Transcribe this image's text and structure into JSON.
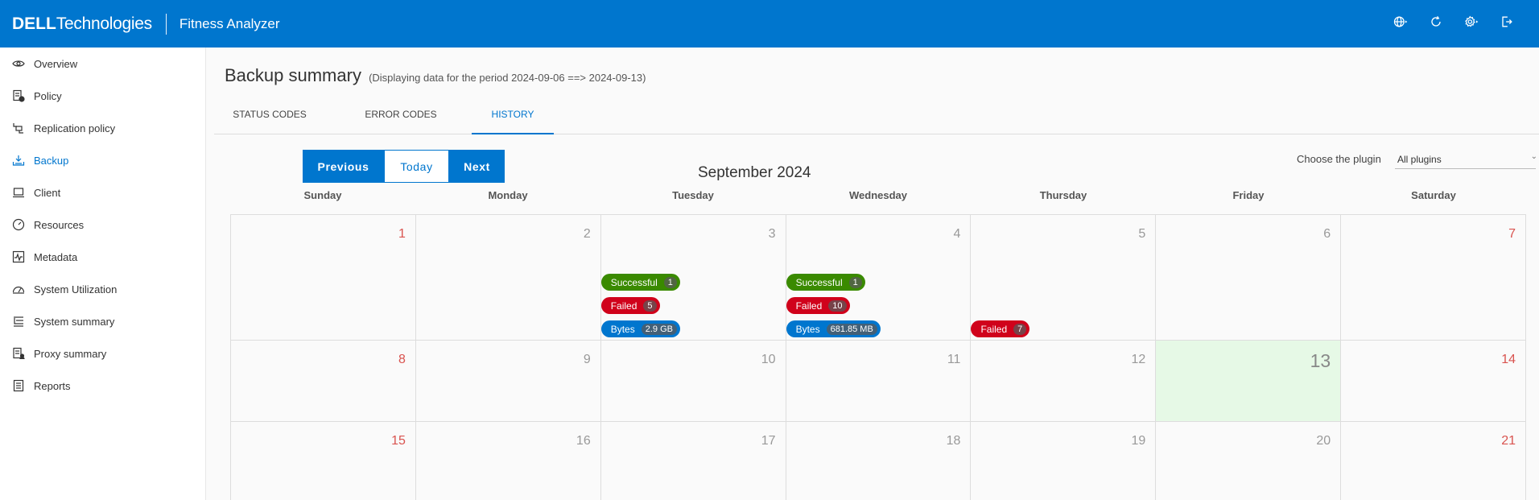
{
  "header": {
    "brand": "DELL",
    "brand_suffix": "Technologies",
    "app_title": "Fitness Analyzer",
    "icons": [
      "globe-icon",
      "refresh-icon",
      "gear-icon",
      "logout-icon"
    ]
  },
  "sidebar": {
    "items": [
      {
        "label": "Overview",
        "icon": "eye-icon",
        "active": false
      },
      {
        "label": "Policy",
        "icon": "policy-icon",
        "active": false
      },
      {
        "label": "Replication policy",
        "icon": "replication-icon",
        "active": false
      },
      {
        "label": "Backup",
        "icon": "backup-icon",
        "active": true
      },
      {
        "label": "Client",
        "icon": "laptop-icon",
        "active": false
      },
      {
        "label": "Resources",
        "icon": "gauge-icon",
        "active": false
      },
      {
        "label": "Metadata",
        "icon": "pulse-icon",
        "active": false
      },
      {
        "label": "System Utilization",
        "icon": "speedometer-icon",
        "active": false
      },
      {
        "label": "System summary",
        "icon": "list-tree-icon",
        "active": false
      },
      {
        "label": "Proxy summary",
        "icon": "proxy-icon",
        "active": false
      },
      {
        "label": "Reports",
        "icon": "report-icon",
        "active": false
      }
    ]
  },
  "main": {
    "title": "Backup summary",
    "subtitle": "(Displaying data for the period 2024-09-06 ==> 2024-09-13)",
    "tabs": [
      {
        "label": "STATUS CODES",
        "active": false
      },
      {
        "label": "ERROR CODES",
        "active": false
      },
      {
        "label": "HISTORY",
        "active": true
      }
    ]
  },
  "calendar": {
    "previous_label": "Previous",
    "today_label": "Today",
    "next_label": "Next",
    "month_title": "September 2024",
    "plugin_label": "Choose the plugin",
    "plugin_value": "All plugins",
    "weekdays": [
      "Sunday",
      "Monday",
      "Tuesday",
      "Wednesday",
      "Thursday",
      "Friday",
      "Saturday"
    ],
    "weeks": [
      [
        {
          "day": "1",
          "weekend": true
        },
        {
          "day": "2"
        },
        {
          "day": "3",
          "events": [
            {
              "type": "success",
              "label": "Successful",
              "count": "1"
            },
            {
              "type": "failed",
              "label": "Failed",
              "count": "5"
            },
            {
              "type": "bytes",
              "label": "Bytes",
              "count": "2.9 GB"
            }
          ]
        },
        {
          "day": "4",
          "events": [
            {
              "type": "success",
              "label": "Successful",
              "count": "1"
            },
            {
              "type": "failed",
              "label": "Failed",
              "count": "10"
            },
            {
              "type": "bytes",
              "label": "Bytes",
              "count": "681.85 MB"
            }
          ]
        },
        {
          "day": "5",
          "events": [
            {
              "type": "failed",
              "label": "Failed",
              "count": "7"
            }
          ]
        },
        {
          "day": "6"
        },
        {
          "day": "7",
          "weekend": true
        }
      ],
      [
        {
          "day": "8",
          "weekend": true
        },
        {
          "day": "9"
        },
        {
          "day": "10"
        },
        {
          "day": "11"
        },
        {
          "day": "12"
        },
        {
          "day": "13",
          "today": true
        },
        {
          "day": "14",
          "weekend": true
        }
      ],
      [
        {
          "day": "15",
          "weekend": true
        },
        {
          "day": "16"
        },
        {
          "day": "17"
        },
        {
          "day": "18"
        },
        {
          "day": "19"
        },
        {
          "day": "20"
        },
        {
          "day": "21",
          "weekend": true
        }
      ]
    ]
  },
  "colors": {
    "header_bg": "#0076ce",
    "accent": "#0076ce",
    "success": "#3a8a00",
    "failed": "#d0021b",
    "bytes": "#0076ce",
    "today_bg": "#e6f9e6",
    "weekend_num": "#d9534f"
  }
}
